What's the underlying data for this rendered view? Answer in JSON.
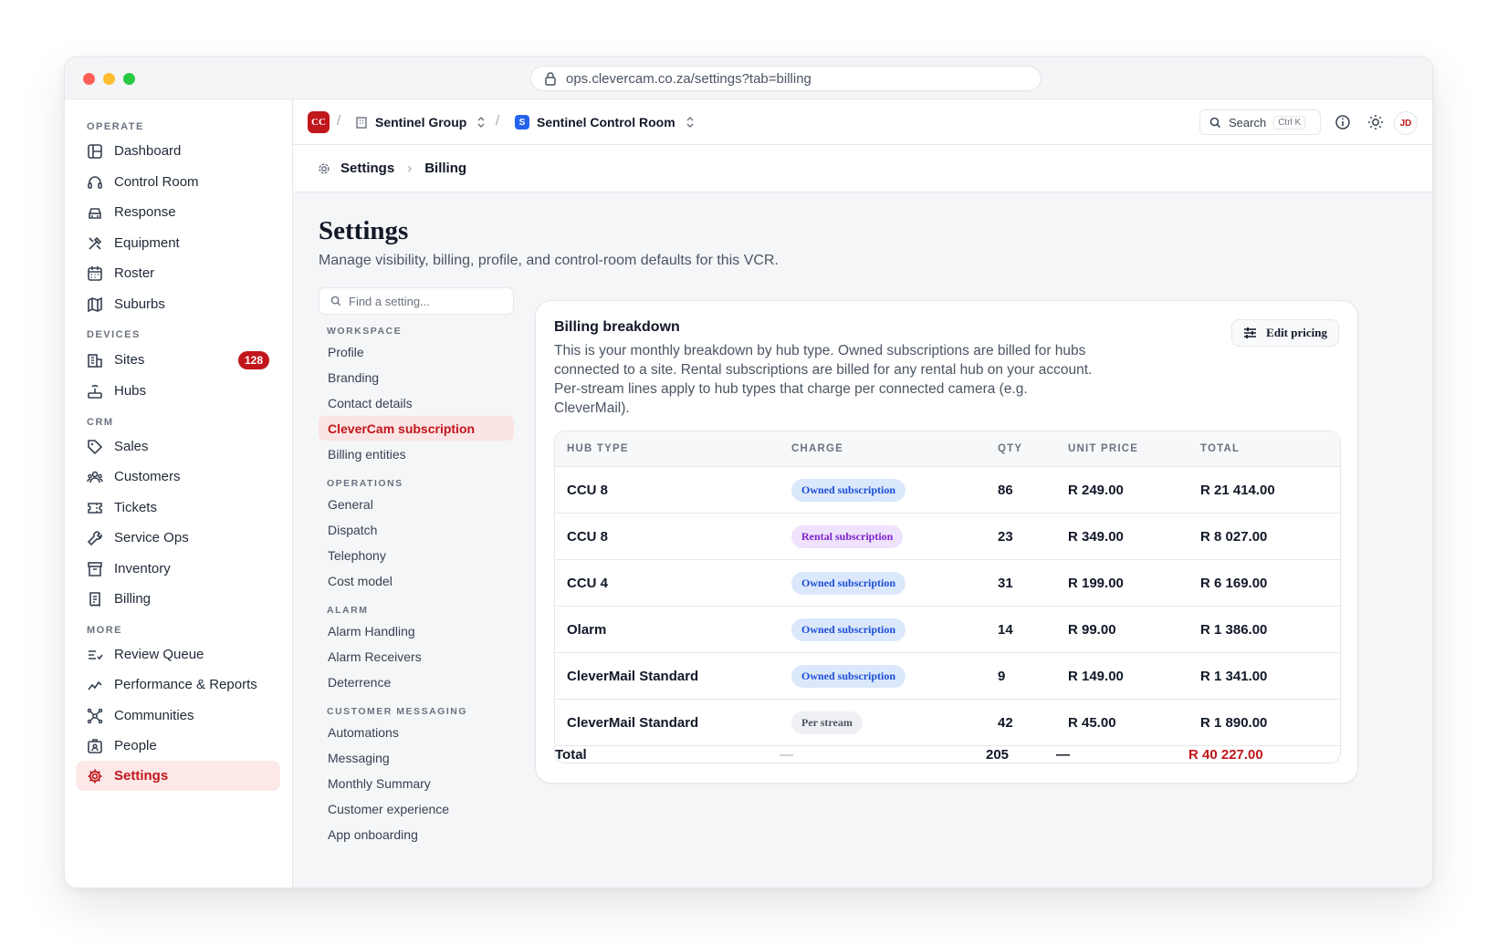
{
  "browser": {
    "url": "ops.clevercam.co.za/settings?tab=billing"
  },
  "sidebar": {
    "sections": [
      {
        "label": "OPERATE",
        "items": [
          {
            "label": "Dashboard",
            "icon": "dashboard-icon"
          },
          {
            "label": "Control Room",
            "icon": "headset-icon"
          },
          {
            "label": "Response",
            "icon": "car-icon"
          },
          {
            "label": "Equipment",
            "icon": "tools-icon"
          },
          {
            "label": "Roster",
            "icon": "calendar-icon"
          },
          {
            "label": "Suburbs",
            "icon": "map-icon"
          }
        ]
      },
      {
        "label": "DEVICES",
        "items": [
          {
            "label": "Sites",
            "icon": "building-icon",
            "badge": "128"
          },
          {
            "label": "Hubs",
            "icon": "router-icon"
          }
        ]
      },
      {
        "label": "CRM",
        "items": [
          {
            "label": "Sales",
            "icon": "tag-icon"
          },
          {
            "label": "Customers",
            "icon": "users-icon"
          },
          {
            "label": "Tickets",
            "icon": "ticket-icon"
          },
          {
            "label": "Service Ops",
            "icon": "wrench-icon"
          },
          {
            "label": "Inventory",
            "icon": "archive-icon"
          },
          {
            "label": "Billing",
            "icon": "receipt-icon"
          }
        ]
      },
      {
        "label": "MORE",
        "items": [
          {
            "label": "Review Queue",
            "icon": "list-check-icon"
          },
          {
            "label": "Performance & Reports",
            "icon": "chart-line-icon"
          },
          {
            "label": "Communities",
            "icon": "network-icon"
          },
          {
            "label": "People",
            "icon": "id-badge-icon"
          },
          {
            "label": "Settings",
            "icon": "gear-icon",
            "active": true
          }
        ]
      }
    ]
  },
  "topbar": {
    "org_logo": "CC",
    "org_name": "Sentinel Group",
    "vcr_logo": "S",
    "vcr_name": "Sentinel Control Room",
    "search_label": "Search",
    "search_shortcut": "Ctrl K",
    "avatar": "JD"
  },
  "breadcrumb": {
    "root": "Settings",
    "current": "Billing"
  },
  "page": {
    "title": "Settings",
    "subtitle": "Manage visibility, billing, profile, and control-room defaults for this VCR."
  },
  "settings_nav": {
    "search_placeholder": "Find a setting...",
    "sections": [
      {
        "label": "WORKSPACE",
        "items": [
          "Profile",
          "Branding",
          "Contact details",
          "CleverCam subscription",
          "Billing entities"
        ]
      },
      {
        "label": "OPERATIONS",
        "items": [
          "General",
          "Dispatch",
          "Telephony",
          "Cost model"
        ]
      },
      {
        "label": "ALARM",
        "items": [
          "Alarm Handling",
          "Alarm Receivers",
          "Deterrence"
        ]
      },
      {
        "label": "CUSTOMER MESSAGING",
        "items": [
          "Automations",
          "Messaging",
          "Monthly Summary",
          "Customer experience",
          "App onboarding"
        ]
      }
    ],
    "active_item": "CleverCam subscription"
  },
  "billing": {
    "title": "Billing breakdown",
    "description": "This is your monthly breakdown by hub type. Owned subscriptions are billed for hubs connected to a site. Rental subscriptions are billed for any rental hub on your account. Per-stream lines apply to hub types that charge per connected camera (e.g. CleverMail).",
    "edit_label": "Edit pricing",
    "columns": [
      "HUB TYPE",
      "CHARGE",
      "QTY",
      "UNIT PRICE",
      "TOTAL"
    ],
    "rows": [
      {
        "hub": "CCU 8",
        "charge": "Owned subscription",
        "kind": "owned",
        "qty": "86",
        "unit": "R 249.00",
        "total": "R 21 414.00"
      },
      {
        "hub": "CCU 8",
        "charge": "Rental subscription",
        "kind": "rental",
        "qty": "23",
        "unit": "R 349.00",
        "total": "R 8 027.00"
      },
      {
        "hub": "CCU 4",
        "charge": "Owned subscription",
        "kind": "owned",
        "qty": "31",
        "unit": "R 199.00",
        "total": "R 6 169.00"
      },
      {
        "hub": "Olarm",
        "charge": "Owned subscription",
        "kind": "owned",
        "qty": "14",
        "unit": "R 99.00",
        "total": "R 1 386.00"
      },
      {
        "hub": "CleverMail Standard",
        "charge": "Owned subscription",
        "kind": "owned",
        "qty": "9",
        "unit": "R 149.00",
        "total": "R 1 341.00"
      },
      {
        "hub": "CleverMail Standard",
        "charge": "Per stream",
        "kind": "stream",
        "qty": "42",
        "unit": "R 45.00",
        "total": "R 1 890.00"
      }
    ],
    "footer": {
      "label": "Total",
      "charge": "—",
      "qty": "205",
      "unit": "—",
      "total": "R 40 227.00"
    },
    "total_color": "#c0161c"
  }
}
